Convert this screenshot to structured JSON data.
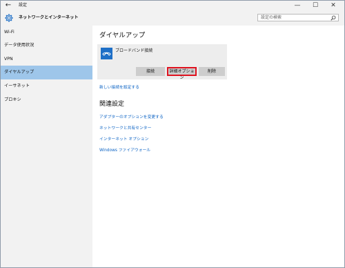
{
  "titlebar": {
    "back_glyph": "←",
    "title": "設定",
    "minimize_glyph": "—",
    "maximize_glyph": "☐",
    "close_glyph": "✕"
  },
  "header": {
    "section_title": "ネットワークとインターネット",
    "search_placeholder": "設定の検索"
  },
  "sidebar": {
    "items": [
      {
        "label": "Wi-Fi",
        "active": false
      },
      {
        "label": "データ使用状況",
        "active": false
      },
      {
        "label": "VPN",
        "active": false
      },
      {
        "label": "ダイヤルアップ",
        "active": true
      },
      {
        "label": "イーサネット",
        "active": false
      },
      {
        "label": "プロキシ",
        "active": false
      }
    ]
  },
  "main": {
    "title": "ダイヤルアップ",
    "connection": {
      "name": "ブロードバンド接続",
      "buttons": {
        "connect": "接続",
        "advanced": "詳細オプション",
        "delete": "削除"
      }
    },
    "new_connection_link": "新しい接続を設定する",
    "related_title": "関連設定",
    "related_links": [
      "アダプターのオプションを変更する",
      "ネットワークと共有センター",
      "インターネット オプション",
      "Windows ファイアウォール"
    ]
  },
  "colors": {
    "accent": "#1e6fc7",
    "link": "#0a62c4",
    "active_nav": "#9ec6ea",
    "highlight_border": "#e0121f"
  }
}
